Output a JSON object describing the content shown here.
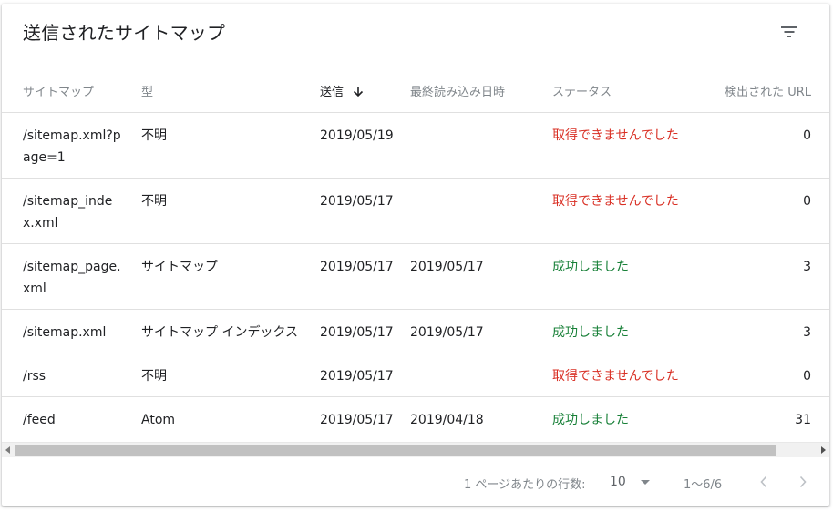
{
  "title": "送信されたサイトマップ",
  "columns": {
    "sitemap": "サイトマップ",
    "type": "型",
    "submitted": "送信",
    "last_read": "最終読み込み日時",
    "status": "ステータス",
    "discovered_urls": "検出された URL"
  },
  "rows": [
    {
      "sitemap": "/sitemap.xml?page=1",
      "type": "不明",
      "submitted": "2019/05/19",
      "last_read": "",
      "status": "取得できませんでした",
      "status_kind": "error",
      "count": "0"
    },
    {
      "sitemap": "/sitemap_index.xml",
      "type": "不明",
      "submitted": "2019/05/17",
      "last_read": "",
      "status": "取得できませんでした",
      "status_kind": "error",
      "count": "0"
    },
    {
      "sitemap": "/sitemap_page.xml",
      "type": "サイトマップ",
      "submitted": "2019/05/17",
      "last_read": "2019/05/17",
      "status": "成功しました",
      "status_kind": "success",
      "count": "3"
    },
    {
      "sitemap": "/sitemap.xml",
      "type": "サイトマップ インデックス",
      "submitted": "2019/05/17",
      "last_read": "2019/05/17",
      "status": "成功しました",
      "status_kind": "success",
      "count": "3"
    },
    {
      "sitemap": "/rss",
      "type": "不明",
      "submitted": "2019/05/17",
      "last_read": "",
      "status": "取得できませんでした",
      "status_kind": "error",
      "count": "0"
    },
    {
      "sitemap": "/feed",
      "type": "Atom",
      "submitted": "2019/05/17",
      "last_read": "2019/04/18",
      "status": "成功しました",
      "status_kind": "success",
      "count": "31"
    }
  ],
  "pagination": {
    "rows_per_page_label": "1 ページあたりの行数:",
    "rows_per_page": "10",
    "range": "1～6/6"
  },
  "colors": {
    "error": "#d93025",
    "success": "#188038",
    "muted": "#80868b"
  },
  "icons": {
    "filter": "filter-icon",
    "sort": "arrow-down-icon",
    "dropdown": "dropdown-arrow-icon",
    "prev": "chevron-left-icon",
    "next": "chevron-right-icon"
  }
}
